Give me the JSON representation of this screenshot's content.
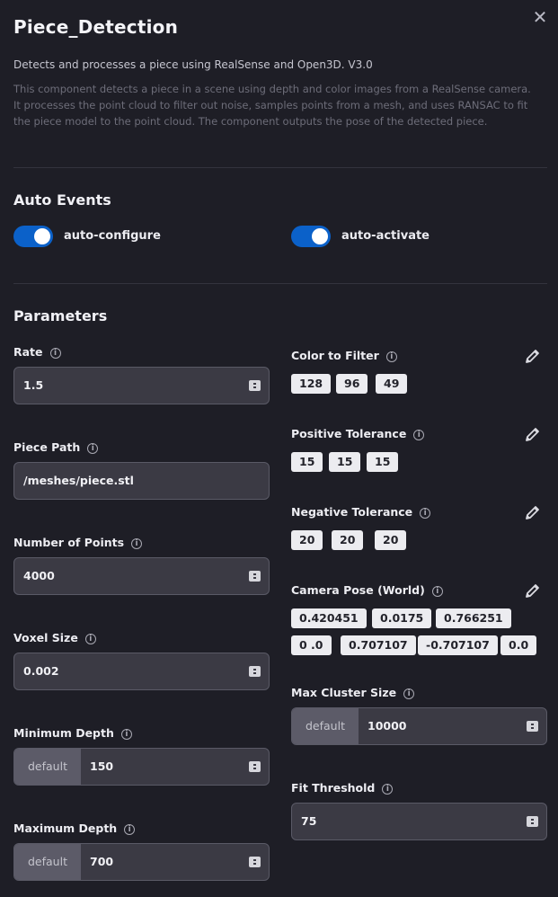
{
  "header": {
    "title": "Piece_Detection",
    "close_glyph": "✕",
    "subtitle": "Detects and processes a piece using RealSense and Open3D. V3.0",
    "description": "This component detects a piece in a scene using depth and color images from a RealSense camera. It processes the point cloud to filter out noise, samples points from a mesh, and uses RANSAC to fit the piece model to the point cloud. The component outputs the pose of the detected piece."
  },
  "auto_events": {
    "heading": "Auto Events",
    "configure": {
      "label": "auto-configure",
      "enabled": true
    },
    "activate": {
      "label": "auto-activate",
      "enabled": true
    }
  },
  "parameters": {
    "heading": "Parameters",
    "info_glyph": "i",
    "rate": {
      "label": "Rate",
      "value": "1.5"
    },
    "piece_path": {
      "label": "Piece Path",
      "value": "/meshes/piece.stl"
    },
    "num_points": {
      "label": "Number of Points",
      "value": "4000"
    },
    "voxel_size": {
      "label": "Voxel Size",
      "value": "0.002"
    },
    "min_depth": {
      "label": "Minimum Depth",
      "prefix": "default",
      "value": "150"
    },
    "max_depth": {
      "label": "Maximum Depth",
      "prefix": "default",
      "value": "700"
    },
    "color_filter": {
      "label": "Color to Filter",
      "values": [
        "128",
        "96",
        "49"
      ]
    },
    "pos_tolerance": {
      "label": "Positive Tolerance",
      "values": [
        "15",
        "15",
        "15"
      ]
    },
    "neg_tolerance": {
      "label": "Negative Tolerance",
      "values": [
        "20",
        "20",
        "20"
      ]
    },
    "camera_pose": {
      "label": "Camera Pose (World)",
      "values": [
        "0.420451",
        "0.0175",
        "0.766251",
        "0 .0",
        "0.707107",
        "-0.707107",
        "0.0"
      ]
    },
    "max_cluster": {
      "label": "Max Cluster Size",
      "prefix": "default",
      "value": "10000"
    },
    "fit_threshold": {
      "label": "Fit Threshold",
      "value": "75"
    }
  },
  "colors": {
    "background": "#1e1e26",
    "accent_toggle": "#0b61c9",
    "field_bg": "#3b3a44",
    "chip_bg": "#ececf0"
  },
  "icons": {
    "close": "close-icon",
    "info": "info-icon",
    "edit": "pencil-icon",
    "spinner": "spinner-icon"
  }
}
